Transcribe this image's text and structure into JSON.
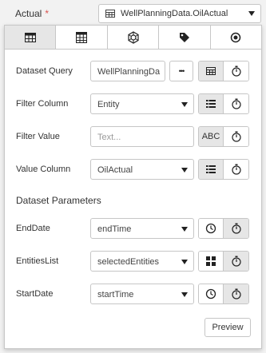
{
  "top": {
    "label": "Actual",
    "required_mark": "*",
    "selected_value": "WellPlanningData.OilActual",
    "icon": "table-icon"
  },
  "tabs": [
    {
      "name": "dataset",
      "icon": "table-icon",
      "active": true
    },
    {
      "name": "calculator",
      "icon": "calculator-icon",
      "active": false
    },
    {
      "name": "network",
      "icon": "network-icon",
      "active": false
    },
    {
      "name": "tag",
      "icon": "tag-icon",
      "active": false
    },
    {
      "name": "radio",
      "icon": "radio-icon",
      "active": false
    }
  ],
  "form": {
    "dataset_query": {
      "label": "Dataset Query",
      "value": "WellPlanningDa",
      "more_label": "•••"
    },
    "filter_column": {
      "label": "Filter Column",
      "value": "Entity"
    },
    "filter_value": {
      "label": "Filter Value",
      "placeholder": "Text...",
      "type_label": "ABC"
    },
    "value_column": {
      "label": "Value Column",
      "value": "OilActual"
    }
  },
  "parameters": {
    "title": "Dataset Parameters",
    "items": [
      {
        "label": "EndDate",
        "value": "endTime",
        "type_icon": "clock-icon"
      },
      {
        "label": "EntitiesList",
        "value": "selectedEntities",
        "type_icon": "grid-icon"
      },
      {
        "label": "StartDate",
        "value": "startTime",
        "type_icon": "clock-icon"
      }
    ]
  },
  "preview_label": "Preview",
  "colors": {
    "active_tab": "#e6e6e6",
    "border": "#c6c6c6",
    "required": "#d9534f"
  }
}
